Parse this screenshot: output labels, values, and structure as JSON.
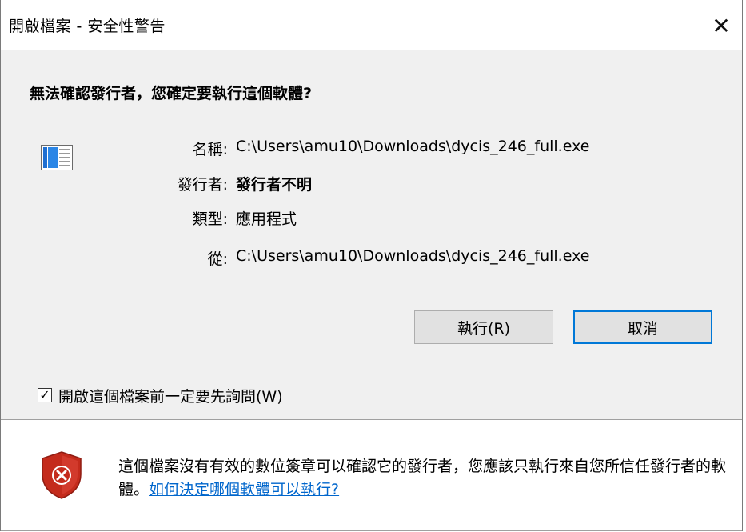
{
  "window": {
    "title": "開啟檔案 - 安全性警告",
    "close_glyph": "✕"
  },
  "heading": "無法確認發行者，您確定要執行這個軟體?",
  "details": {
    "name_label": "名稱:",
    "name_value": "C:\\Users\\amu10\\Downloads\\dycis_246_full.exe",
    "publisher_label": "發行者:",
    "publisher_value": "發行者不明",
    "type_label": "類型:",
    "type_value": "應用程式",
    "from_label": "從:",
    "from_value": "C:\\Users\\amu10\\Downloads\\dycis_246_full.exe"
  },
  "buttons": {
    "run": "執行(R)",
    "cancel": "取消"
  },
  "checkbox": {
    "label": "開啟這個檔案前一定要先詢問(W)",
    "checked": true,
    "mark": "✓"
  },
  "footer": {
    "warning_text": "這個檔案沒有有效的數位簽章可以確認它的發行者，您應該只執行來自您所信任發行者的軟體。",
    "link_text": "如何決定哪個軟體可以執行?"
  },
  "colors": {
    "accent": "#0078d7",
    "link": "#0066cc",
    "shield_red": "#c42b1c",
    "panel_bg": "#f0f0f0"
  },
  "icons": {
    "app": "application-window-icon",
    "shield": "security-shield-error-icon",
    "close": "close-icon"
  }
}
